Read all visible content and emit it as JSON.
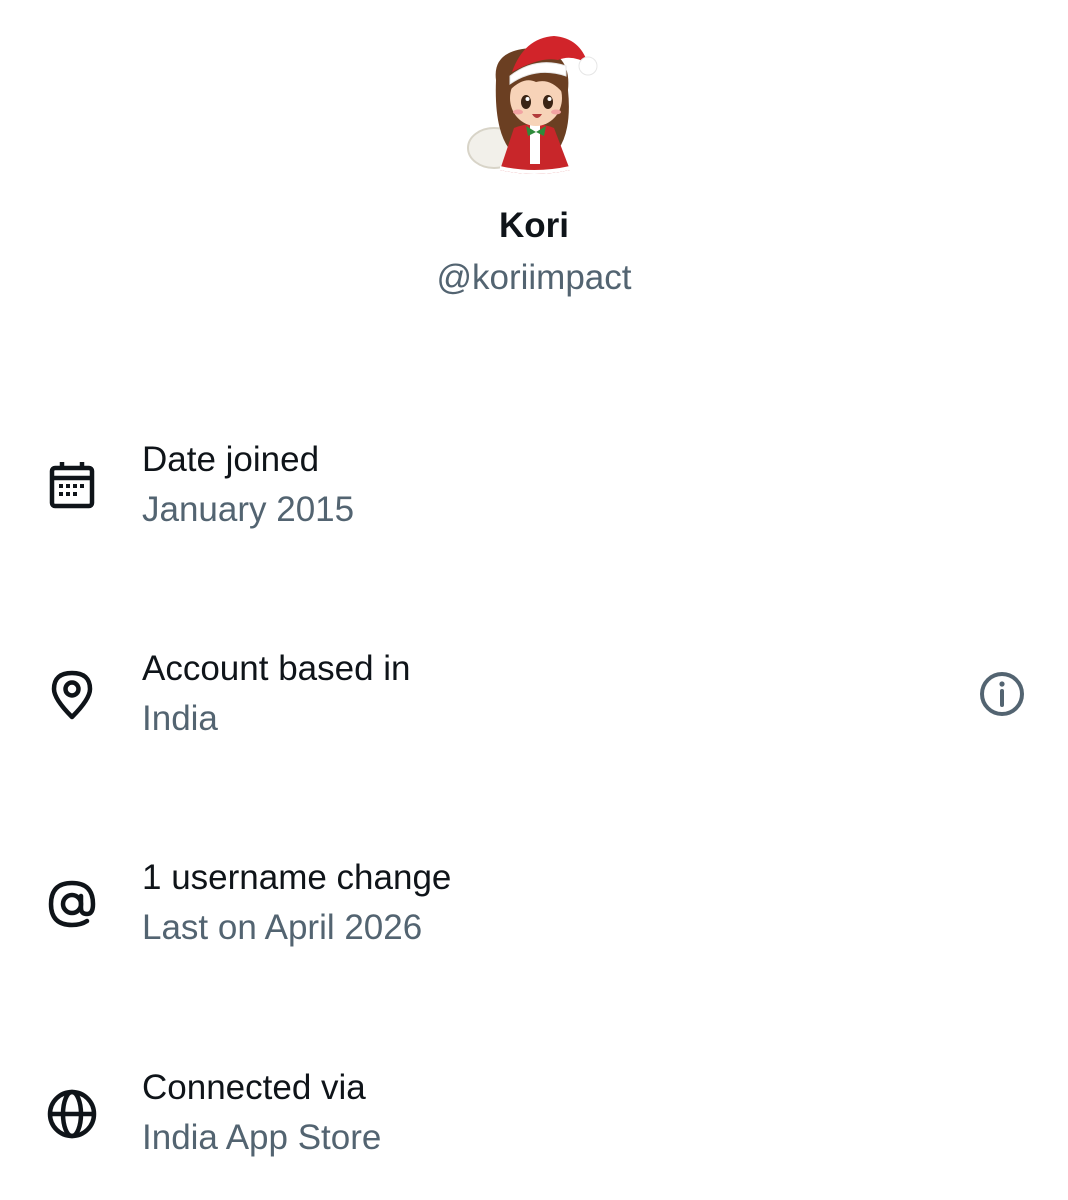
{
  "profile": {
    "display_name": "Kori",
    "handle": "@koriimpact",
    "avatar_icon": "santa-hat-girl-avatar"
  },
  "rows": [
    {
      "icon": "calendar-icon",
      "title": "Date joined",
      "value": "January 2015"
    },
    {
      "icon": "location-pin-icon",
      "title": "Account based in",
      "value": "India",
      "action_icon": "info-icon"
    },
    {
      "icon": "at-sign-icon",
      "title": "1 username change",
      "value": "Last on April 2026"
    },
    {
      "icon": "globe-icon",
      "title": "Connected via",
      "value": "India App Store"
    }
  ],
  "colors": {
    "primary_text": "#0f1419",
    "secondary_text": "#536471"
  }
}
